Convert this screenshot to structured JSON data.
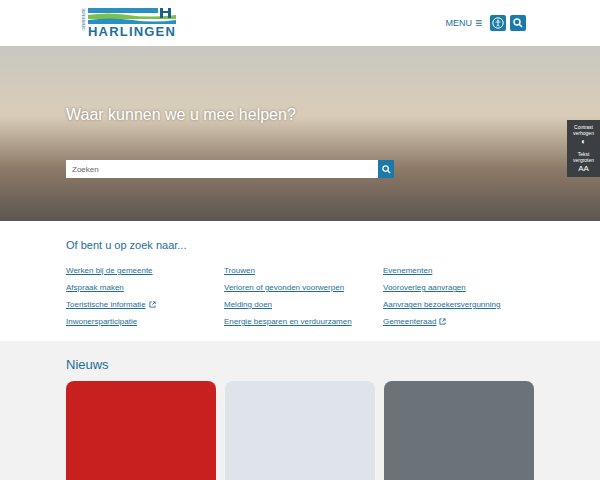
{
  "header": {
    "logo_small": "GEMEENTE",
    "logo_name": "HARLINGEN",
    "menu_label": "MENU",
    "menu_glyph": "≡"
  },
  "hero": {
    "title": "Waar kunnen we u mee helpen?",
    "search": {
      "placeholder": "Zoeken"
    }
  },
  "side_panel": [
    {
      "label": "Contrast verhogen",
      "glyph": "◐"
    },
    {
      "label": "Tekst vergroten",
      "glyph": "AA"
    }
  ],
  "quick_links": {
    "title": "Of bent u op zoek naar...",
    "items": [
      {
        "label": "Werken bij de gemeente",
        "external": false
      },
      {
        "label": "Trouwen",
        "external": false
      },
      {
        "label": "Evenementen",
        "external": false
      },
      {
        "label": "Afspraak maken",
        "external": false
      },
      {
        "label": "Verloren of gevonden voorwerpen",
        "external": false
      },
      {
        "label": "Vooroverleg aanvragen",
        "external": false
      },
      {
        "label": "Toeristische informatie",
        "external": true
      },
      {
        "label": "Melding doen",
        "external": false
      },
      {
        "label": "Aanvragen bezoekersvergunning",
        "external": false
      },
      {
        "label": "Inwonersparticipatie",
        "external": false
      },
      {
        "label": "Energie besparen en verduurzamen",
        "external": false
      },
      {
        "label": "Gemeenteraad",
        "external": true
      }
    ]
  },
  "news": {
    "title": "Nieuws",
    "cards": [
      {
        "kind": "photo"
      },
      {
        "kind": "photo"
      },
      {
        "kind": "photo"
      }
    ]
  }
}
